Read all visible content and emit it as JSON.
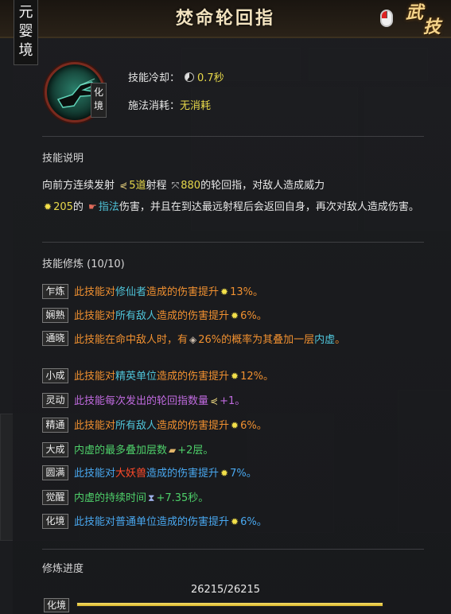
{
  "header": {
    "title": "焚命轮回指",
    "realm": [
      "元",
      "婴",
      "境"
    ],
    "badge": [
      "武",
      "技"
    ]
  },
  "skill": {
    "icon": "pointing-hand-icon",
    "realm_tag": "化境",
    "cooldown_label": "技能冷却：",
    "cooldown_value": "0.7秒",
    "cost_label": "施法消耗：",
    "cost_value": "无消耗"
  },
  "description": {
    "title": "技能说明",
    "parts": {
      "p1": "向前方连续发射",
      "count": "5道",
      "p2": "射程",
      "range": "880",
      "p3": "的轮回指，对敌人造成威力",
      "power": "205",
      "p4": "的",
      "dmg_type": "指法",
      "p5": "伤害，并且在到达最远射程后会返回自身，再次对敌人造成伤害。"
    }
  },
  "training": {
    "title": "技能修炼 (10/10)",
    "rows": [
      {
        "tag": "乍炼",
        "pre": "此技能对",
        "hl": "修仙者",
        "post": "造成的伤害提升",
        "icon": "sun-icon",
        "val": "13%。",
        "color": "orange"
      },
      {
        "tag": "娴熟",
        "pre": "此技能对",
        "hl": "所有敌人",
        "post": "造成的伤害提升",
        "icon": "sun-icon",
        "val": "6%。",
        "color": "orange"
      },
      {
        "tag": "通晓",
        "pre": "此技能在命中敌人时，有",
        "hl": "",
        "post": "",
        "icon": "stone-icon",
        "val": "26%的概率为其叠加一层",
        "extra": "内虚",
        "extra2": "。",
        "color": "orange"
      },
      {
        "tag": "小成",
        "pre": "此技能对",
        "hl": "精英单位",
        "post": "造成的伤害提升",
        "icon": "sun-icon",
        "val": "12%。",
        "color": "orange"
      },
      {
        "tag": "灵动",
        "pre": "此技能每次发出的轮回指数量",
        "hl": "",
        "post": "",
        "icon": "bolt-icon",
        "val": "+1。",
        "color": "purple"
      },
      {
        "tag": "精通",
        "pre": "此技能对",
        "hl": "所有敌人",
        "post": "造成的伤害提升",
        "icon": "sun-icon",
        "val": "6%。",
        "color": "orange"
      },
      {
        "tag": "大成",
        "pre": "内虚的最多叠加层数",
        "hl": "",
        "post": "",
        "icon": "paper-icon",
        "val": "+2层。",
        "color": "green"
      },
      {
        "tag": "圆满",
        "pre": "此技能对",
        "hl": "大妖兽",
        "post": "造成的伤害提升",
        "icon": "sun-icon",
        "val": "7%。",
        "color": "blue-red"
      },
      {
        "tag": "觉醒",
        "pre": "内虚的持续时间",
        "hl": "",
        "post": "",
        "icon": "hourglass-icon",
        "val": "+7.35秒。",
        "color": "green"
      },
      {
        "tag": "化境",
        "pre": "此技能对",
        "hl": "普通单位",
        "post": "造成的伤害提升",
        "icon": "sun-icon",
        "val": "6%。",
        "color": "blue"
      }
    ]
  },
  "progress": {
    "title": "修炼进度",
    "value": "26215/26215",
    "tag": "化境",
    "fraction": 1.0
  },
  "colors": {
    "accent_yellow": "#e7d84a",
    "cyan": "#4fc3d8",
    "orange": "#f09030",
    "purple": "#c06adf",
    "green": "#4ed06a",
    "blue": "#49a8f0",
    "red": "#ff4a2a"
  }
}
